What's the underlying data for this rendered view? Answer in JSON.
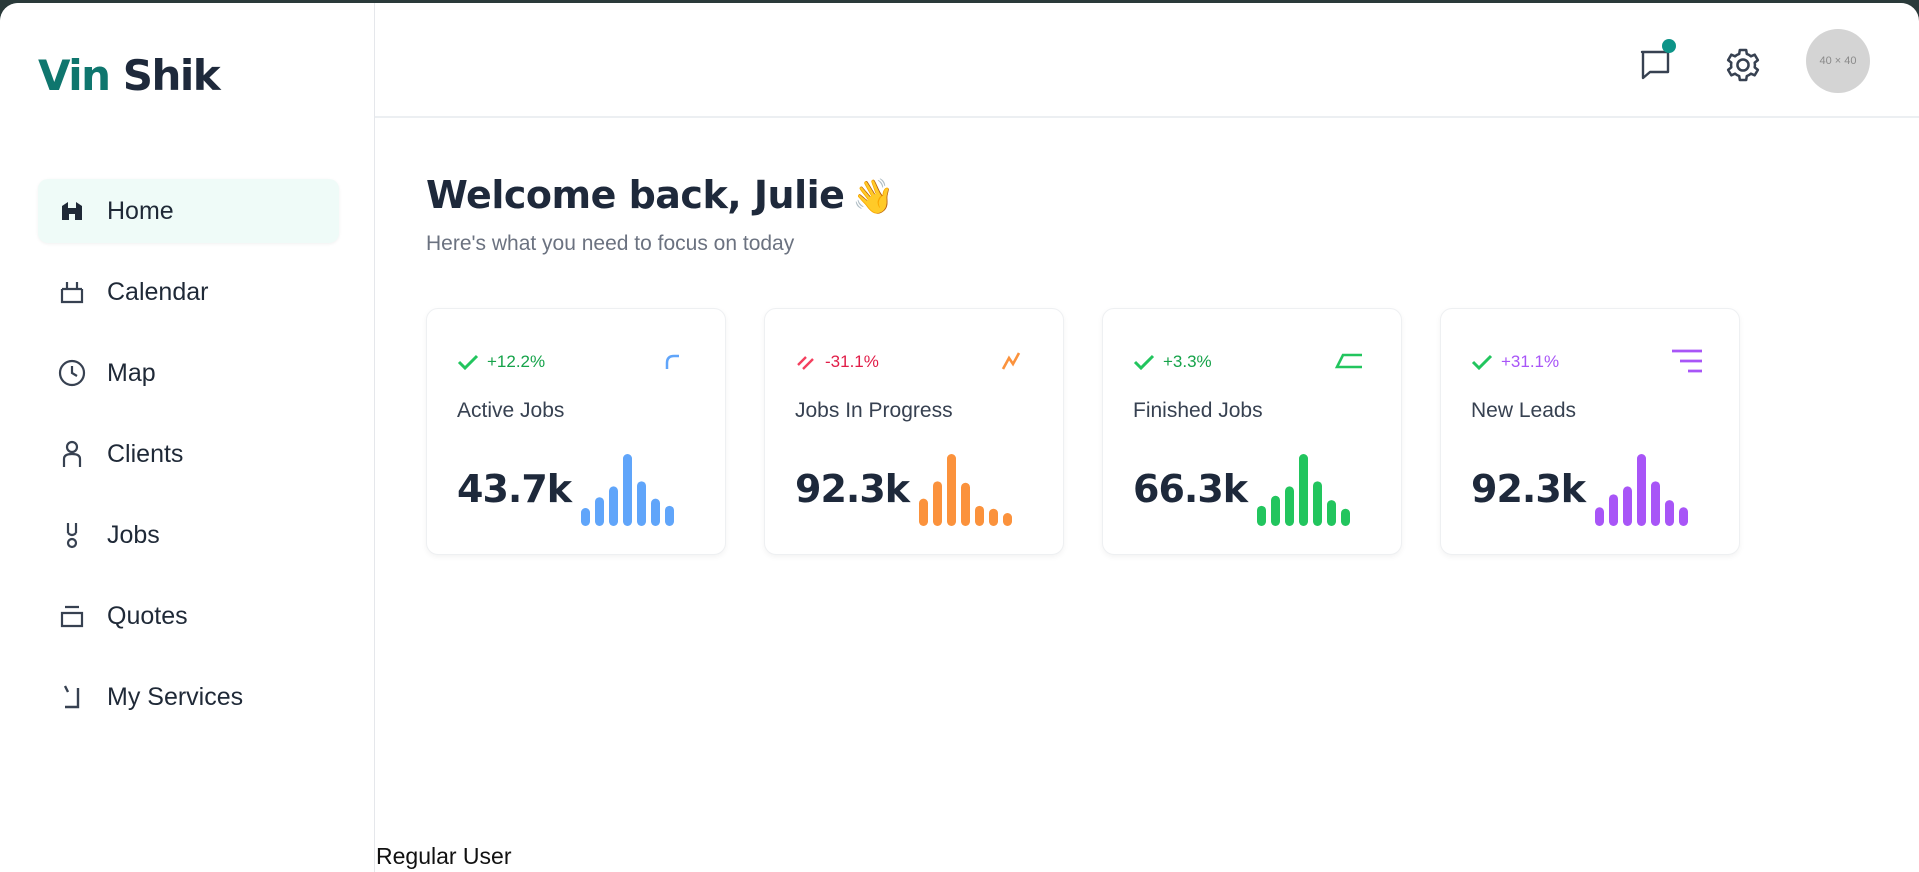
{
  "brand": {
    "part1": "Vin",
    "part2": "Shik"
  },
  "sidebar": {
    "items": [
      {
        "label": "Home",
        "icon": "home-icon",
        "active": true
      },
      {
        "label": "Calendar",
        "icon": "calendar-icon",
        "active": false
      },
      {
        "label": "Map",
        "icon": "clock-icon",
        "active": false
      },
      {
        "label": "Clients",
        "icon": "user-icon",
        "active": false
      },
      {
        "label": "Jobs",
        "icon": "tool-icon",
        "active": false
      },
      {
        "label": "Quotes",
        "icon": "inbox-icon",
        "active": false
      },
      {
        "label": "My Services",
        "icon": "service-icon",
        "active": false
      }
    ]
  },
  "header": {
    "avatar_text": "40 × 40",
    "notification_dot_color": "#0d9488"
  },
  "main": {
    "welcome": "Welcome back, Julie",
    "wave_emoji": "👋",
    "subtitle": "Here's what you need to focus on today"
  },
  "cards": [
    {
      "title": "Active Jobs",
      "value": "43.7k",
      "trend": "+12.2%",
      "trend_dir": "up",
      "trend_color": "#22c55e",
      "trend_text_color": "#16a34a",
      "accent": "#60a5fa",
      "icon": "arc-icon",
      "bars": [
        0.25,
        0.4,
        0.55,
        1.0,
        0.62,
        0.38,
        0.28
      ]
    },
    {
      "title": "Jobs In Progress",
      "value": "92.3k",
      "trend": "-31.1%",
      "trend_dir": "down",
      "trend_color": "#f43f5e",
      "trend_text_color": "#e11d48",
      "accent": "#fb923c",
      "icon": "zigzag-icon",
      "bars": [
        0.38,
        0.62,
        1.0,
        0.6,
        0.28,
        0.24,
        0.18
      ]
    },
    {
      "title": "Finished Jobs",
      "value": "66.3k",
      "trend": "+3.3%",
      "trend_dir": "up",
      "trend_color": "#22c55e",
      "trend_text_color": "#16a34a",
      "accent": "#22c55e",
      "icon": "parallelogram-icon",
      "bars": [
        0.28,
        0.42,
        0.55,
        1.0,
        0.62,
        0.36,
        0.24
      ]
    },
    {
      "title": "New Leads",
      "value": "92.3k",
      "trend": "+31.1%",
      "trend_dir": "up",
      "trend_color": "#22c55e",
      "trend_text_color": "#a855f7",
      "accent": "#a855f7",
      "icon": "lines-icon",
      "bars": [
        0.26,
        0.44,
        0.55,
        1.0,
        0.62,
        0.36,
        0.26
      ]
    }
  ],
  "footer": {
    "user_role": "Regular User"
  }
}
